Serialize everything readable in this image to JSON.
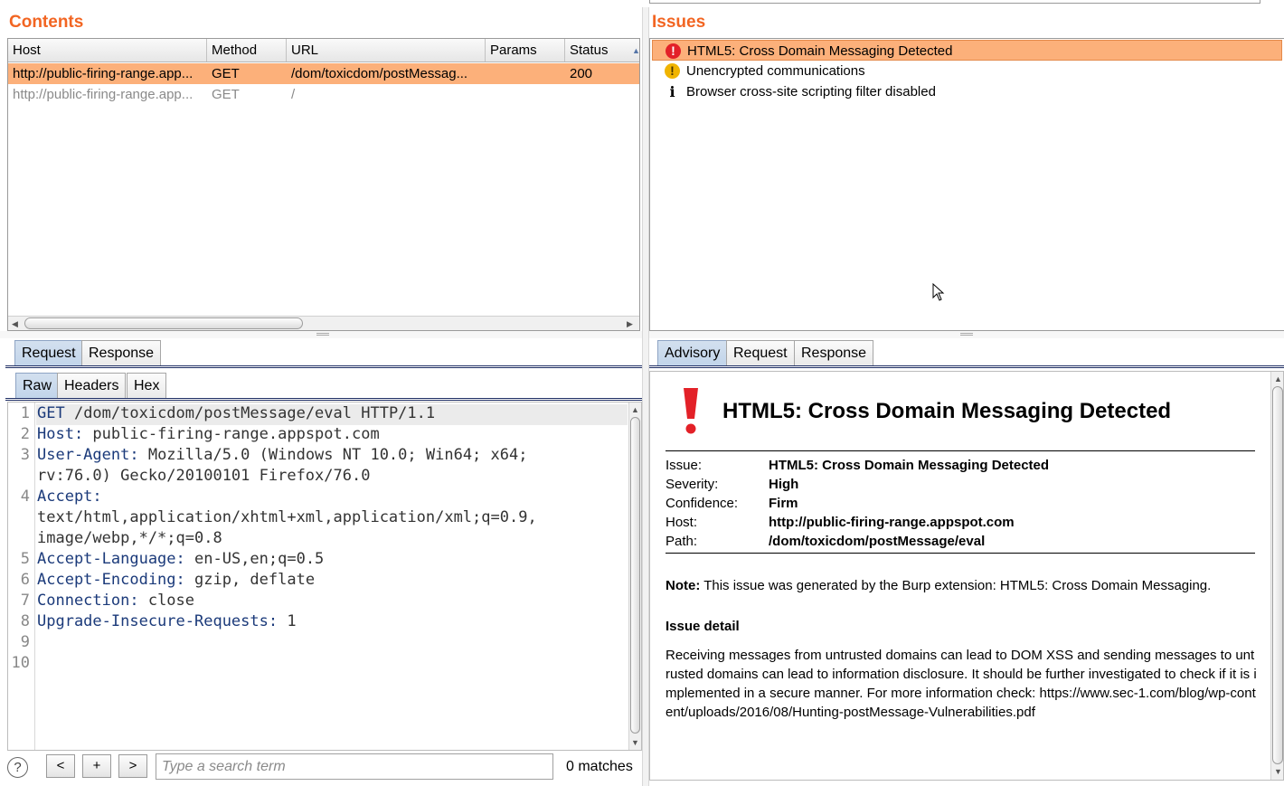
{
  "contents": {
    "title": "Contents",
    "columns": [
      "Host",
      "Method",
      "URL",
      "Params",
      "Status"
    ],
    "sort_indicator": "▲",
    "rows": [
      {
        "host": "http://public-firing-range.app...",
        "method": "GET",
        "url": "/dom/toxicdom/postMessag...",
        "params": "",
        "status": "200",
        "selected": true
      },
      {
        "host": "http://public-firing-range.app...",
        "method": "GET",
        "url": "/",
        "params": "",
        "status": "",
        "selected": false
      }
    ]
  },
  "issues": {
    "title": "Issues",
    "items": [
      {
        "label": "HTML5: Cross Domain Messaging Detected",
        "severity": "high",
        "icon": "!",
        "selected": true
      },
      {
        "label": "Unencrypted communications",
        "severity": "medium",
        "icon": "!",
        "selected": false
      },
      {
        "label": "Browser cross-site scripting filter disabled",
        "severity": "info",
        "icon": "i",
        "selected": false
      }
    ]
  },
  "left_tabs": {
    "request": "Request",
    "response": "Response",
    "active": "Request"
  },
  "view_tabs": {
    "raw": "Raw",
    "headers": "Headers",
    "hex": "Hex",
    "active": "Raw"
  },
  "editor": {
    "lines": [
      {
        "n": "1",
        "key": "GET",
        "rest": " /dom/toxicdom/postMessage/eval HTTP/1.1"
      },
      {
        "n": "2",
        "key": "Host:",
        "rest": " public-firing-range.appspot.com"
      },
      {
        "n": "3",
        "key": "User-Agent:",
        "rest": " Mozilla/5.0 (Windows NT 10.0; Win64; x64;"
      },
      {
        "n": "",
        "key": "",
        "rest": "rv:76.0) Gecko/20100101 Firefox/76.0"
      },
      {
        "n": "4",
        "key": "Accept:",
        "rest": ""
      },
      {
        "n": "",
        "key": "",
        "rest": "text/html,application/xhtml+xml,application/xml;q=0.9,"
      },
      {
        "n": "",
        "key": "",
        "rest": "image/webp,*/*;q=0.8"
      },
      {
        "n": "5",
        "key": "Accept-Language:",
        "rest": " en-US,en;q=0.5"
      },
      {
        "n": "6",
        "key": "Accept-Encoding:",
        "rest": " gzip, deflate"
      },
      {
        "n": "7",
        "key": "Connection:",
        "rest": " close"
      },
      {
        "n": "8",
        "key": "Upgrade-Insecure-Requests:",
        "rest": " 1"
      },
      {
        "n": "9",
        "key": "",
        "rest": ""
      },
      {
        "n": "10",
        "key": "",
        "rest": ""
      }
    ]
  },
  "search": {
    "help": "?",
    "prev": "<",
    "add": "+",
    "next": ">",
    "placeholder": "Type a search term",
    "matches": "0 matches"
  },
  "right_tabs": {
    "advisory": "Advisory",
    "request": "Request",
    "response": "Response",
    "active": "Advisory"
  },
  "advisory": {
    "title": "HTML5: Cross Domain Messaging Detected",
    "fields": [
      {
        "key": "Issue:",
        "value": "HTML5: Cross Domain Messaging Detected"
      },
      {
        "key": "Severity:",
        "value": "High"
      },
      {
        "key": "Confidence:",
        "value": "Firm"
      },
      {
        "key": "Host:",
        "value": "http://public-firing-range.appspot.com"
      },
      {
        "key": "Path:",
        "value": "/dom/toxicdom/postMessage/eval"
      }
    ],
    "note_label": "Note:",
    "note_text": " This issue was generated by the Burp extension: HTML5: Cross Domain Messaging.",
    "detail_heading": "Issue detail",
    "detail_text": "Receiving messages from untrusted domains can lead to DOM XSS and sending messages to untrusted domains can lead to information disclosure. It should be further investigated to check if it is implemented in a secure manner. For more information check: https://www.sec-1.com/blog/wp-content/uploads/2016/08/Hunting-postMessage-Vulnerabilities.pdf"
  },
  "colors": {
    "accent": "#f26522",
    "selection": "#fcb07a",
    "high": "#e32128",
    "medium": "#f0b400",
    "tab_active": "#c1d4ea"
  }
}
